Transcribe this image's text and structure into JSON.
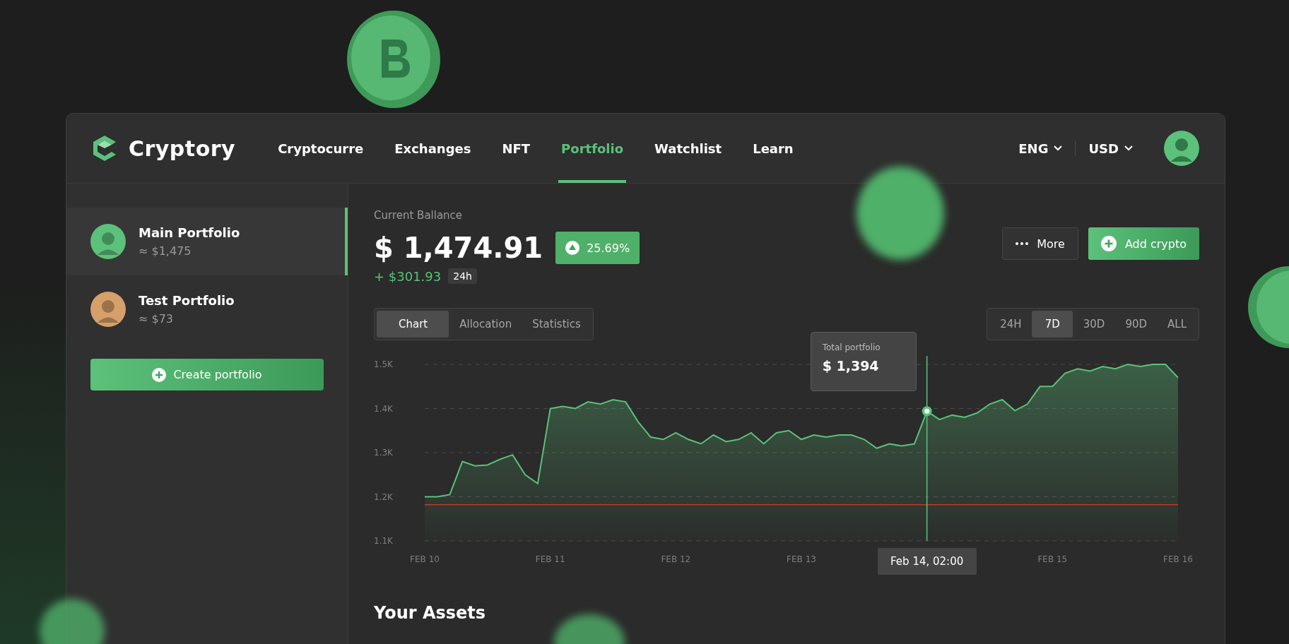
{
  "brand": {
    "name": "Cryptory"
  },
  "nav": [
    {
      "label": "Cryptocurre",
      "selected": false
    },
    {
      "label": "Exchanges",
      "selected": false
    },
    {
      "label": "NFT",
      "selected": false
    },
    {
      "label": "Portfolio",
      "selected": true
    },
    {
      "label": "Watchlist",
      "selected": false
    },
    {
      "label": "Learn",
      "selected": false
    }
  ],
  "language": "ENG",
  "currency": "USD",
  "portfolios": [
    {
      "name": "Main Portfolio",
      "value": "≈ $1,475",
      "selected": true,
      "color": "#5cc17a"
    },
    {
      "name": "Test Portfolio",
      "value": "≈ $73",
      "selected": false,
      "color": "#d6a06a"
    }
  ],
  "create_button": "Create portfolio",
  "balance": {
    "label": "Current Ballance",
    "amount": "$ 1,474.91",
    "change_pct": "25.69%",
    "change": "+ $301.93",
    "period": "24h"
  },
  "actions": {
    "more": "More",
    "add": "Add crypto"
  },
  "view_tabs": [
    {
      "label": "Chart",
      "selected": true
    },
    {
      "label": "Allocation",
      "selected": false
    },
    {
      "label": "Statistics",
      "selected": false
    }
  ],
  "ranges": [
    {
      "label": "24H",
      "selected": false
    },
    {
      "label": "7D",
      "selected": true
    },
    {
      "label": "30D",
      "selected": false
    },
    {
      "label": "90D",
      "selected": false
    },
    {
      "label": "ALL",
      "selected": false
    }
  ],
  "chart": {
    "tooltip": {
      "value": "$ 1,394",
      "date": "Feb 14, 02:00"
    },
    "chart_data": {
      "type": "area",
      "grid": true,
      "ylim": [
        1100,
        1500
      ],
      "categories": [
        "FEB 10",
        null,
        null,
        null,
        null,
        null,
        null,
        null,
        null,
        null,
        "FEB 11",
        null,
        null,
        null,
        null,
        null,
        null,
        null,
        null,
        null,
        "FEB 12",
        null,
        null,
        null,
        null,
        null,
        null,
        null,
        null,
        null,
        "FEB 13",
        null,
        null,
        null,
        null,
        null,
        null,
        null,
        null,
        null,
        null,
        null,
        null,
        null,
        null,
        null,
        null,
        null,
        null,
        null,
        "FEB 15",
        null,
        null,
        null,
        null,
        null,
        null,
        null,
        null,
        null,
        "FEB 16"
      ],
      "yticks": [
        {
          "value": 1100,
          "label": "1.1K"
        },
        {
          "value": 1200,
          "label": "1.2K"
        },
        {
          "value": 1300,
          "label": "1.3K"
        },
        {
          "value": 1400,
          "label": "1.4K"
        },
        {
          "value": 1500,
          "label": "1.5K"
        }
      ],
      "series": [
        {
          "name": "Total portfolio",
          "type": "area",
          "color": "#5cc17a",
          "values": [
            1200,
            1200,
            1205,
            1280,
            1270,
            1272,
            1285,
            1295,
            1250,
            1230,
            1400,
            1405,
            1400,
            1415,
            1410,
            1420,
            1415,
            1370,
            1335,
            1330,
            1345,
            1330,
            1320,
            1340,
            1325,
            1330,
            1345,
            1320,
            1345,
            1350,
            1330,
            1340,
            1335,
            1340,
            1340,
            1330,
            1310,
            1320,
            1315,
            1320,
            1394,
            1375,
            1385,
            1380,
            1390,
            1410,
            1420,
            1395,
            1410,
            1450,
            1450,
            1480,
            1490,
            1485,
            1495,
            1490,
            1500,
            1495,
            1500,
            1500,
            1470
          ]
        },
        {
          "type": "line",
          "color": "#c0392b",
          "values": [
            1182,
            1182,
            1182,
            1182,
            1182,
            1182,
            1182,
            1182,
            1182,
            1182,
            1182,
            1182,
            1182,
            1182,
            1182,
            1182,
            1182,
            1182,
            1182,
            1182,
            1182,
            1182,
            1182,
            1182,
            1182,
            1182,
            1182,
            1182,
            1182,
            1182,
            1182,
            1182,
            1182,
            1182,
            1182,
            1182,
            1182,
            1182,
            1182,
            1182,
            1182,
            1182,
            1182,
            1182,
            1182,
            1182,
            1182,
            1182,
            1182,
            1182,
            1182,
            1182,
            1182,
            1182,
            1182,
            1182,
            1182,
            1182,
            1182,
            1182,
            1182
          ]
        }
      ]
    }
  },
  "assets_title": "Your Assets"
}
